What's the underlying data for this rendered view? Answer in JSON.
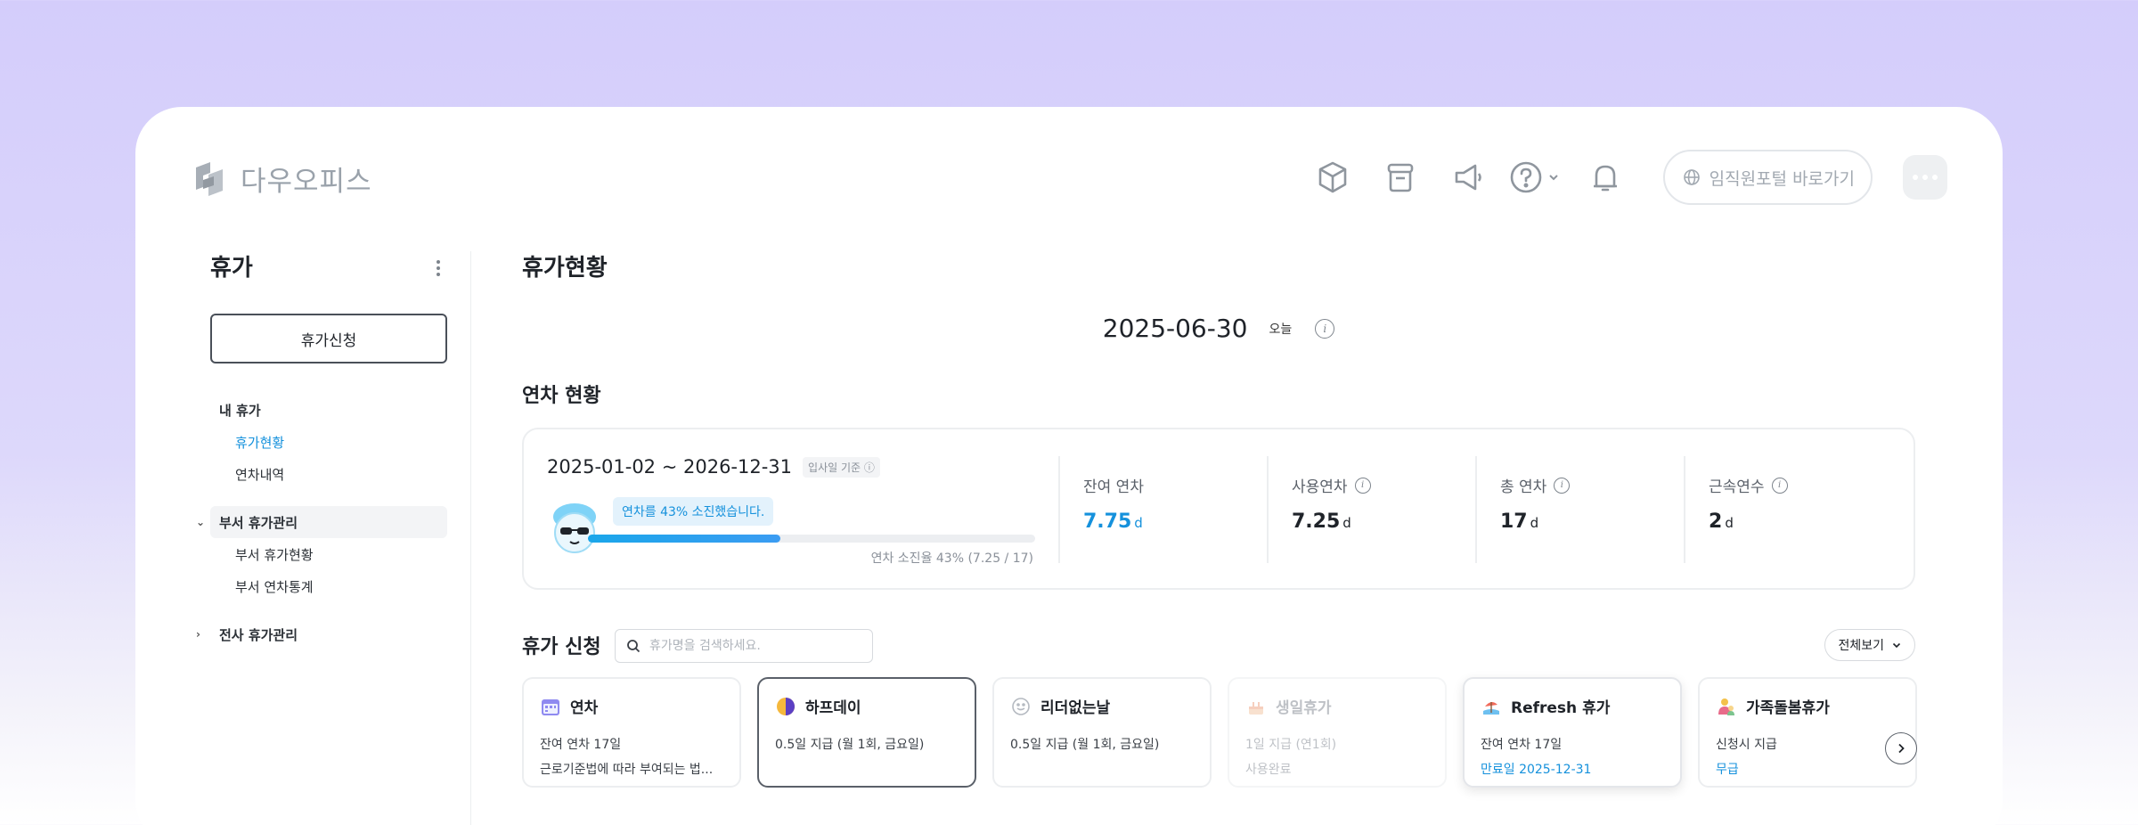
{
  "header": {
    "logo_text": "다우오피스",
    "portal_button": "임직원포털 바로가기"
  },
  "sidebar": {
    "title": "휴가",
    "apply_button": "휴가신청",
    "items": [
      {
        "label": "내 휴가"
      },
      {
        "label": "휴가현황"
      },
      {
        "label": "연차내역"
      },
      {
        "label": "부서 휴가관리"
      },
      {
        "label": "부서 휴가현황"
      },
      {
        "label": "부서 연차통계"
      },
      {
        "label": "전사 휴가관리"
      }
    ]
  },
  "main": {
    "page_title": "휴가현황",
    "date": "2025-06-30",
    "today_label": "오늘",
    "annual_section_title": "연차 현황",
    "annual": {
      "period": "2025-01-02 ~ 2026-12-31",
      "basis": "입사일 기준",
      "bubble": "연차를 43% 소진했습니다.",
      "progress_pct": 43,
      "ratio_text": "연차 소진율 43% (7.25 / 17)",
      "stats": [
        {
          "label": "잔여 연차",
          "value": "7.75",
          "unit": "d",
          "info": false
        },
        {
          "label": "사용연차",
          "value": "7.25",
          "unit": "d",
          "info": true
        },
        {
          "label": "총 연차",
          "value": "17",
          "unit": "d",
          "info": true
        },
        {
          "label": "근속연수",
          "value": "2",
          "unit": "d",
          "info": true
        }
      ]
    },
    "request_section_title": "휴가 신청",
    "search_placeholder": "휴가명을 검색하세요.",
    "view_all": "전체보기",
    "cards": [
      {
        "title": "연차",
        "line1": "잔여 연차 17일",
        "line2": "근로기준법에 따라 부여되는 법..."
      },
      {
        "title": "하프데이",
        "line1": "0.5일 지급 (월 1회, 금요일)",
        "line2": ""
      },
      {
        "title": "리더없는날",
        "line1": "0.5일 지급 (월 1회, 금요일)",
        "line2": ""
      },
      {
        "title": "생일휴가",
        "line1": "1일 지급 (연1회)",
        "line2": "사용완료"
      },
      {
        "title": "Refresh 휴가",
        "line1": "잔여 연차 17일",
        "line2": "만료일 2025-12-31"
      },
      {
        "title": "가족돌봄휴가",
        "line1": "신청시 지급",
        "line2": "무급"
      }
    ]
  },
  "colors": {
    "accent": "#1591dc",
    "progress": "#1aa6ea",
    "background_top": "#d4cdfb"
  }
}
